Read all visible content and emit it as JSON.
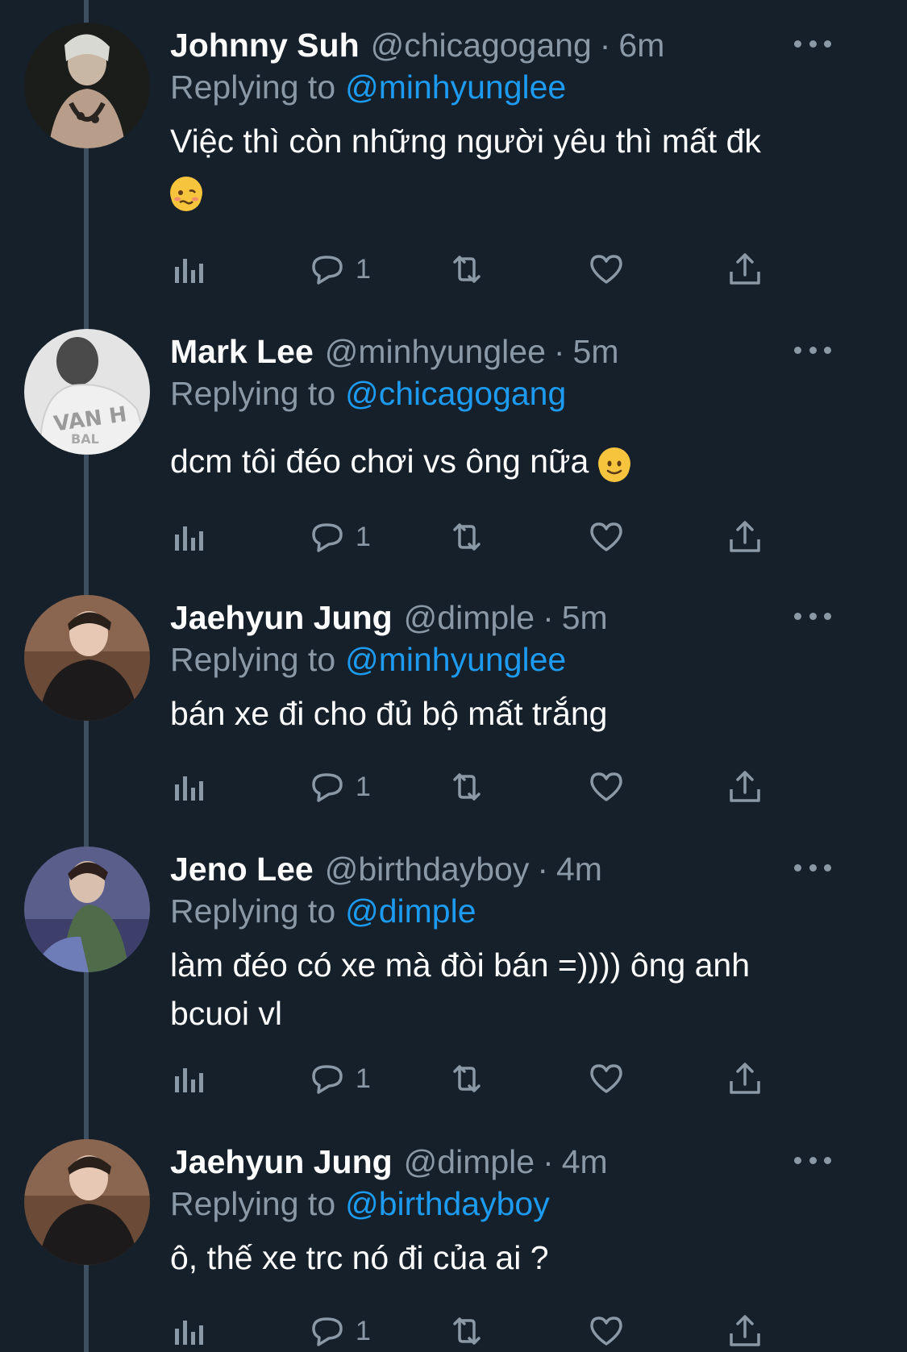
{
  "tweets": [
    {
      "name": "Johnny Suh",
      "handle": "@chicagogang",
      "sep": "·",
      "time": "6m",
      "replying_label": "Replying to",
      "replying_to": "@minhyunglee",
      "text": " Việc thì còn những người yêu thì mất đk",
      "emoji": "woozy-face",
      "reply_count": "1"
    },
    {
      "name": "Mark Lee",
      "handle": "@minhyunglee",
      "sep": "·",
      "time": "5m",
      "replying_label": "Replying to",
      "replying_to": "@chicagogang",
      "text": "dcm tôi đéo chơi vs ông nữa ",
      "emoji": "slightly-smiling-face",
      "reply_count": "1"
    },
    {
      "name": "Jaehyun Jung",
      "handle": "@dimple",
      "sep": "·",
      "time": "5m",
      "replying_label": "Replying to",
      "replying_to": "@minhyunglee",
      "text": "bán xe đi cho đủ bộ mất trắng",
      "reply_count": "1"
    },
    {
      "name": "Jeno Lee",
      "handle": "@birthdayboy",
      "sep": "·",
      "time": "4m",
      "replying_label": "Replying to",
      "replying_to": "@dimple",
      "text": "làm đéo có xe mà đòi bán =)))) ông anh bcuoi vl",
      "reply_count": "1"
    },
    {
      "name": "Jaehyun Jung",
      "handle": "@dimple",
      "sep": "·",
      "time": "4m",
      "replying_label": "Replying to",
      "replying_to": "@birthdayboy",
      "text": "ô, thế xe trc nó đi của ai ?",
      "reply_count": "1"
    }
  ],
  "icons": {
    "views": "analytics-icon",
    "reply": "reply-bubble-icon",
    "retweet": "retweet-icon",
    "like": "heart-icon",
    "share": "share-icon",
    "more": "more-dots-icon"
  },
  "colors": {
    "background": "#15202b",
    "accent": "#1d9bf0",
    "secondary_text": "#8b98a5",
    "thread_line": "#3d4f60"
  }
}
